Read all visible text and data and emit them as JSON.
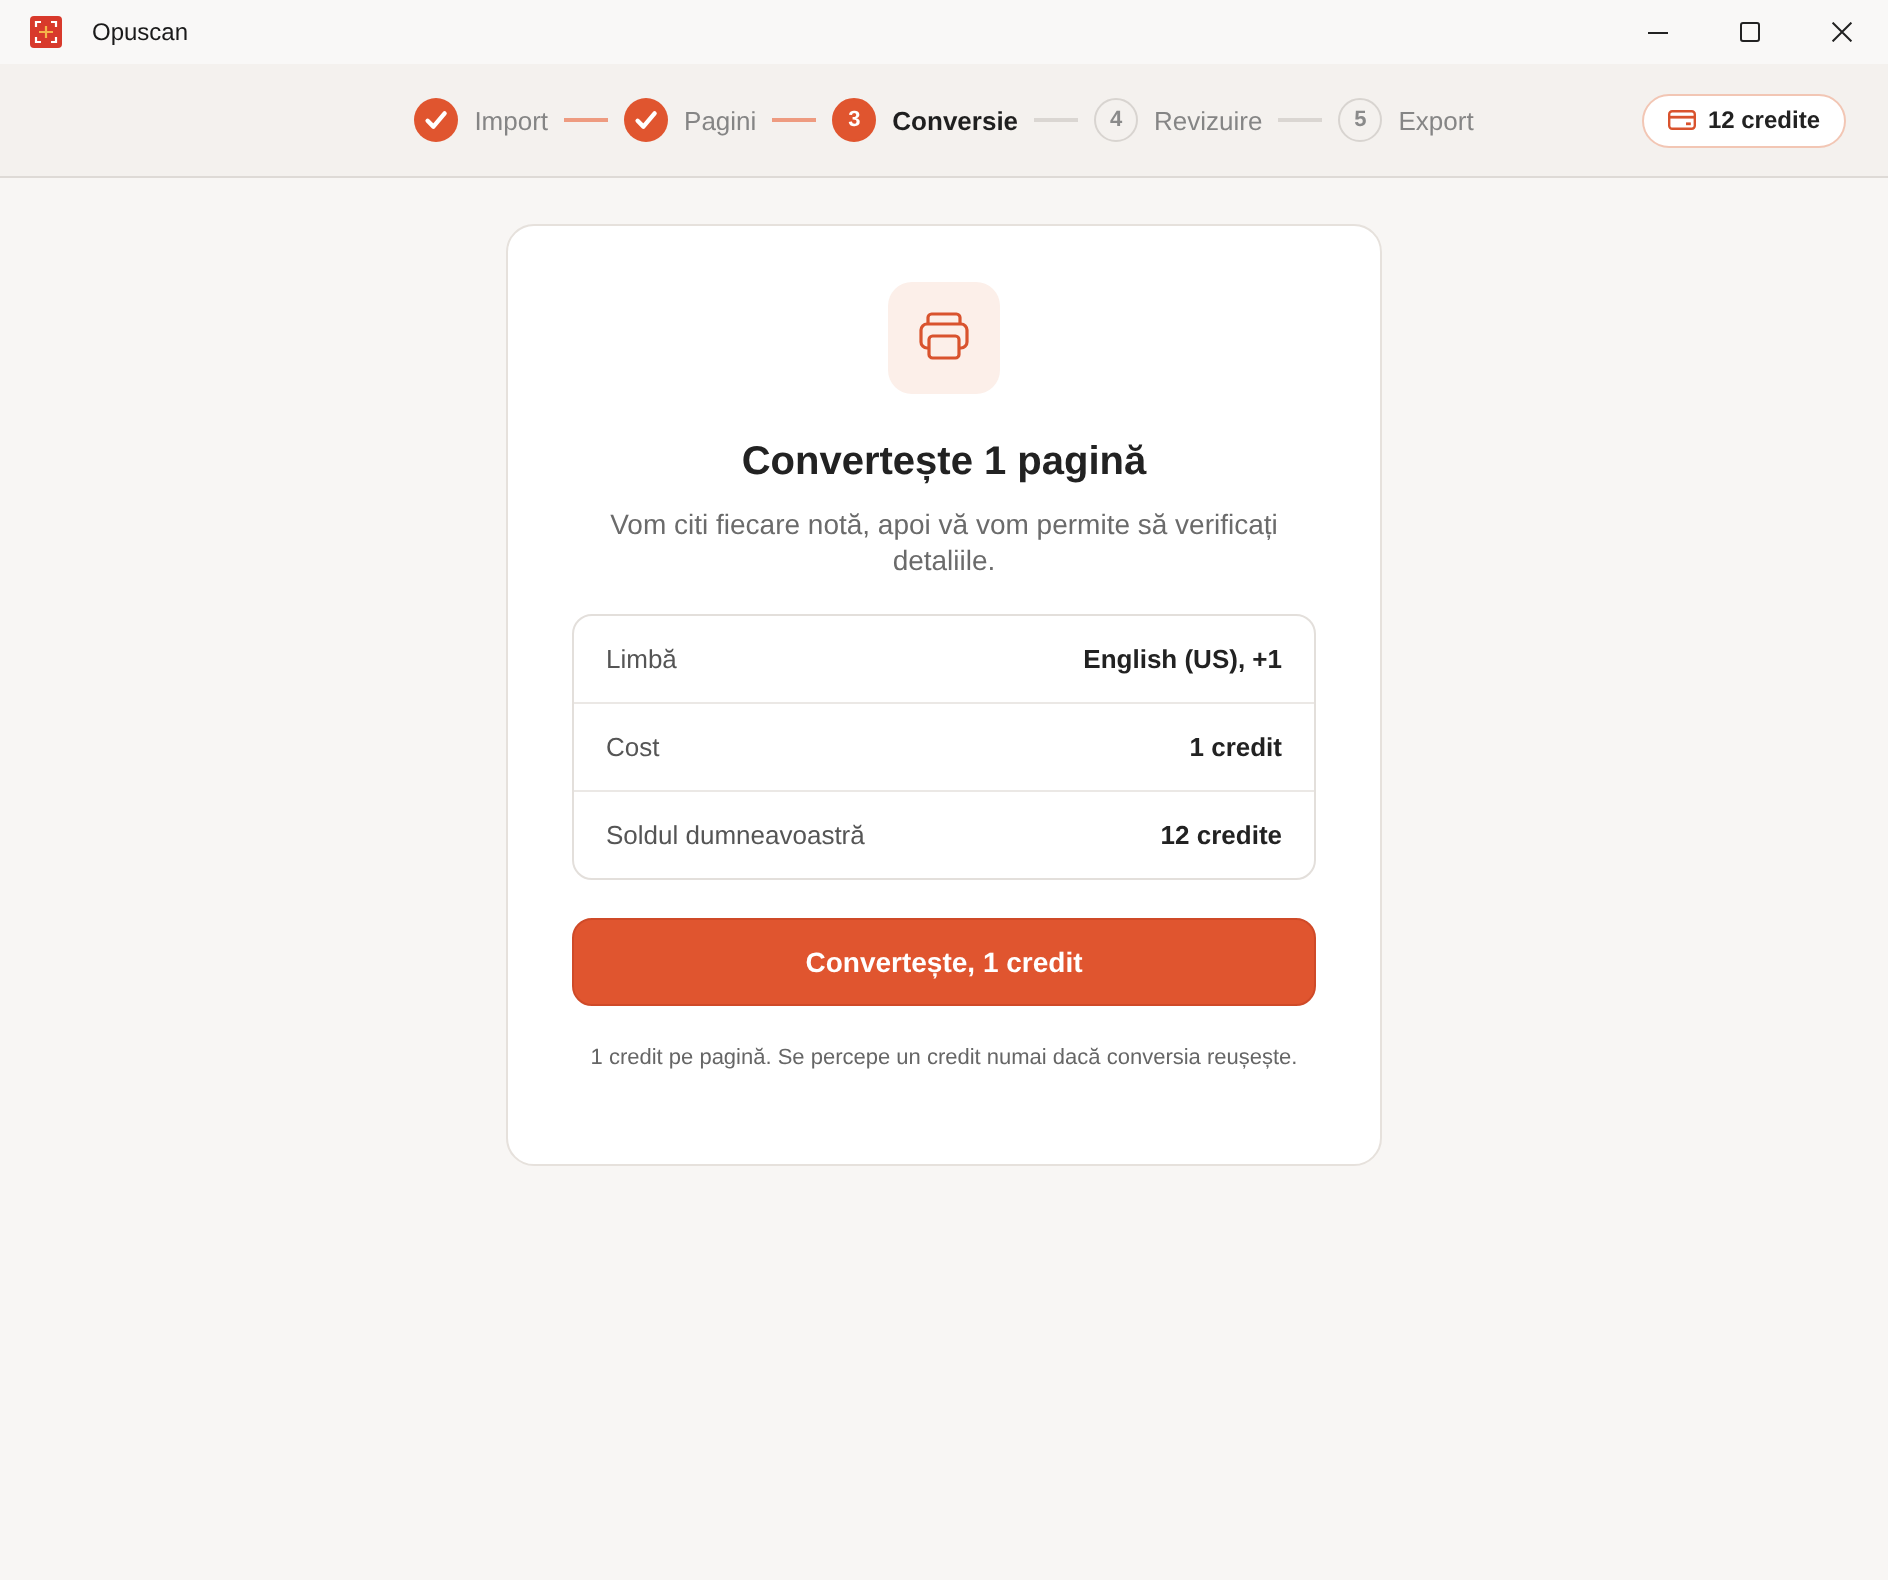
{
  "window": {
    "title": "Opuscan"
  },
  "steps": [
    {
      "label": "Import",
      "done": true,
      "selected": false
    },
    {
      "label": "Pagini",
      "done": true,
      "selected": false
    },
    {
      "number": "3",
      "label": "Conversie",
      "done": false,
      "selected": true
    },
    {
      "number": "4",
      "label": "Revizuire",
      "done": false,
      "selected": false
    },
    {
      "number": "5",
      "label": "Export",
      "done": false,
      "selected": false
    }
  ],
  "credits_button": {
    "label": "12 credite"
  },
  "card": {
    "title": "Convertește 1 pagină",
    "subtitle": "Vom citi fiecare notă, apoi vă vom permite să verificați detaliile.",
    "details": [
      {
        "label": "Limbă",
        "value": "English (US), +1"
      },
      {
        "label": "Cost",
        "value": "1 credit"
      },
      {
        "label": "Soldul dumneavoastră",
        "value": "12 credite"
      }
    ],
    "button": "Convertește, 1 credit",
    "note": "1 credit pe pagină. Se percepe un credit numai dacă conversia reușește."
  }
}
